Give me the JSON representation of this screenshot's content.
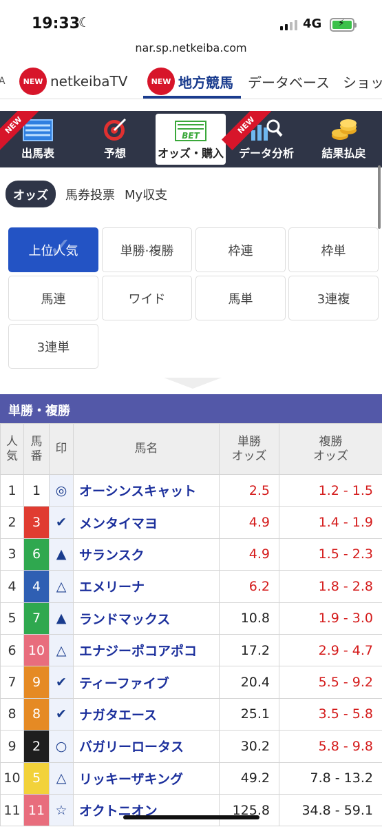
{
  "status": {
    "time": "19:33",
    "network": "4G"
  },
  "url": "nar.sp.netkeiba.com",
  "topnav": {
    "items": [
      {
        "label": "A"
      },
      {
        "badge": "NEW",
        "label": "netkeibaTV"
      },
      {
        "badge": "NEW",
        "label": "地方競馬"
      },
      {
        "label": "データベース"
      },
      {
        "label": "ショッ"
      }
    ]
  },
  "menu": {
    "ribbon": "NEW",
    "items": [
      {
        "label": "出馬表",
        "icon": "race-card-icon"
      },
      {
        "label": "予想",
        "icon": "target-icon"
      },
      {
        "label": "オッズ・購入",
        "icon": "bet-icon",
        "icon_text": "BET"
      },
      {
        "label": "データ分析",
        "icon": "data-analysis-icon"
      },
      {
        "label": "結果払戻",
        "icon": "coins-icon"
      }
    ]
  },
  "subtabs": [
    "オッズ",
    "馬券投票",
    "My収支"
  ],
  "bet_types": [
    "上位人気",
    "単勝·複勝",
    "枠連",
    "枠単",
    "馬連",
    "ワイド",
    "馬単",
    "3連複",
    "3連単"
  ],
  "section_title": "単勝・複勝",
  "table": {
    "headers": {
      "ninki": [
        "人",
        "気"
      ],
      "umaban": [
        "馬",
        "番"
      ],
      "mark": "印",
      "name": "馬名",
      "win": [
        "単勝",
        "オッズ"
      ],
      "place": [
        "複勝",
        "オッズ"
      ]
    },
    "rows": [
      {
        "ninki": "1",
        "umaban": "1",
        "mark": "◎",
        "name": "オーシンスキャット",
        "win": "2.5",
        "place": "1.2 - 1.5",
        "win_red": true,
        "place_red": true,
        "waku_bg": "#ffffff",
        "waku_fg": "#222222"
      },
      {
        "ninki": "2",
        "umaban": "3",
        "mark": "✔",
        "name": "メンタイマヨ",
        "win": "4.9",
        "place": "1.4 - 1.9",
        "win_red": true,
        "place_red": true,
        "waku_bg": "#e03c31",
        "waku_fg": "#ffffff"
      },
      {
        "ninki": "3",
        "umaban": "6",
        "mark": "▲",
        "name": "サランスク",
        "win": "4.9",
        "place": "1.5 - 2.3",
        "win_red": true,
        "place_red": true,
        "waku_bg": "#2fa84f",
        "waku_fg": "#ffffff"
      },
      {
        "ninki": "4",
        "umaban": "4",
        "mark": "△",
        "name": "エメリーナ",
        "win": "6.2",
        "place": "1.8 - 2.8",
        "win_red": true,
        "place_red": true,
        "waku_bg": "#2f5fb3",
        "waku_fg": "#ffffff"
      },
      {
        "ninki": "5",
        "umaban": "7",
        "mark": "▲",
        "name": "ランドマックス",
        "win": "10.8",
        "place": "1.9 - 3.0",
        "win_red": false,
        "place_red": true,
        "waku_bg": "#2fa84f",
        "waku_fg": "#ffffff"
      },
      {
        "ninki": "6",
        "umaban": "10",
        "mark": "△",
        "name": "エナジーポコアポコ",
        "win": "17.2",
        "place": "2.9 - 4.7",
        "win_red": false,
        "place_red": true,
        "waku_bg": "#e86d7d",
        "waku_fg": "#ffffff"
      },
      {
        "ninki": "7",
        "umaban": "9",
        "mark": "✔",
        "name": "ティーファイブ",
        "win": "20.4",
        "place": "5.5 - 9.2",
        "win_red": false,
        "place_red": true,
        "waku_bg": "#e58a24",
        "waku_fg": "#ffffff"
      },
      {
        "ninki": "8",
        "umaban": "8",
        "mark": "✔",
        "name": "ナガタエース",
        "win": "25.1",
        "place": "3.5 - 5.8",
        "win_red": false,
        "place_red": true,
        "waku_bg": "#e58a24",
        "waku_fg": "#ffffff"
      },
      {
        "ninki": "9",
        "umaban": "2",
        "mark": "○",
        "name": "バガリーロータス",
        "win": "30.2",
        "place": "5.8 - 9.8",
        "win_red": false,
        "place_red": true,
        "waku_bg": "#1e1e1e",
        "waku_fg": "#ffffff"
      },
      {
        "ninki": "10",
        "umaban": "5",
        "mark": "△",
        "name": "リッキーザキング",
        "win": "49.2",
        "place": "7.8 - 13.2",
        "win_red": false,
        "place_red": false,
        "waku_bg": "#f2d23a",
        "waku_fg": "#ffffff"
      },
      {
        "ninki": "11",
        "umaban": "11",
        "mark": "☆",
        "name": "オクトニオン",
        "win": "125.8",
        "place": "34.8 - 59.1",
        "win_red": false,
        "place_red": false,
        "waku_bg": "#e86d7d",
        "waku_fg": "#ffffff"
      }
    ]
  },
  "colors": {
    "accent": "#2353c4",
    "dark_menu": "#2f3547",
    "section": "#5358a8",
    "red": "#d41a1a",
    "new_badge": "#d7152a"
  }
}
